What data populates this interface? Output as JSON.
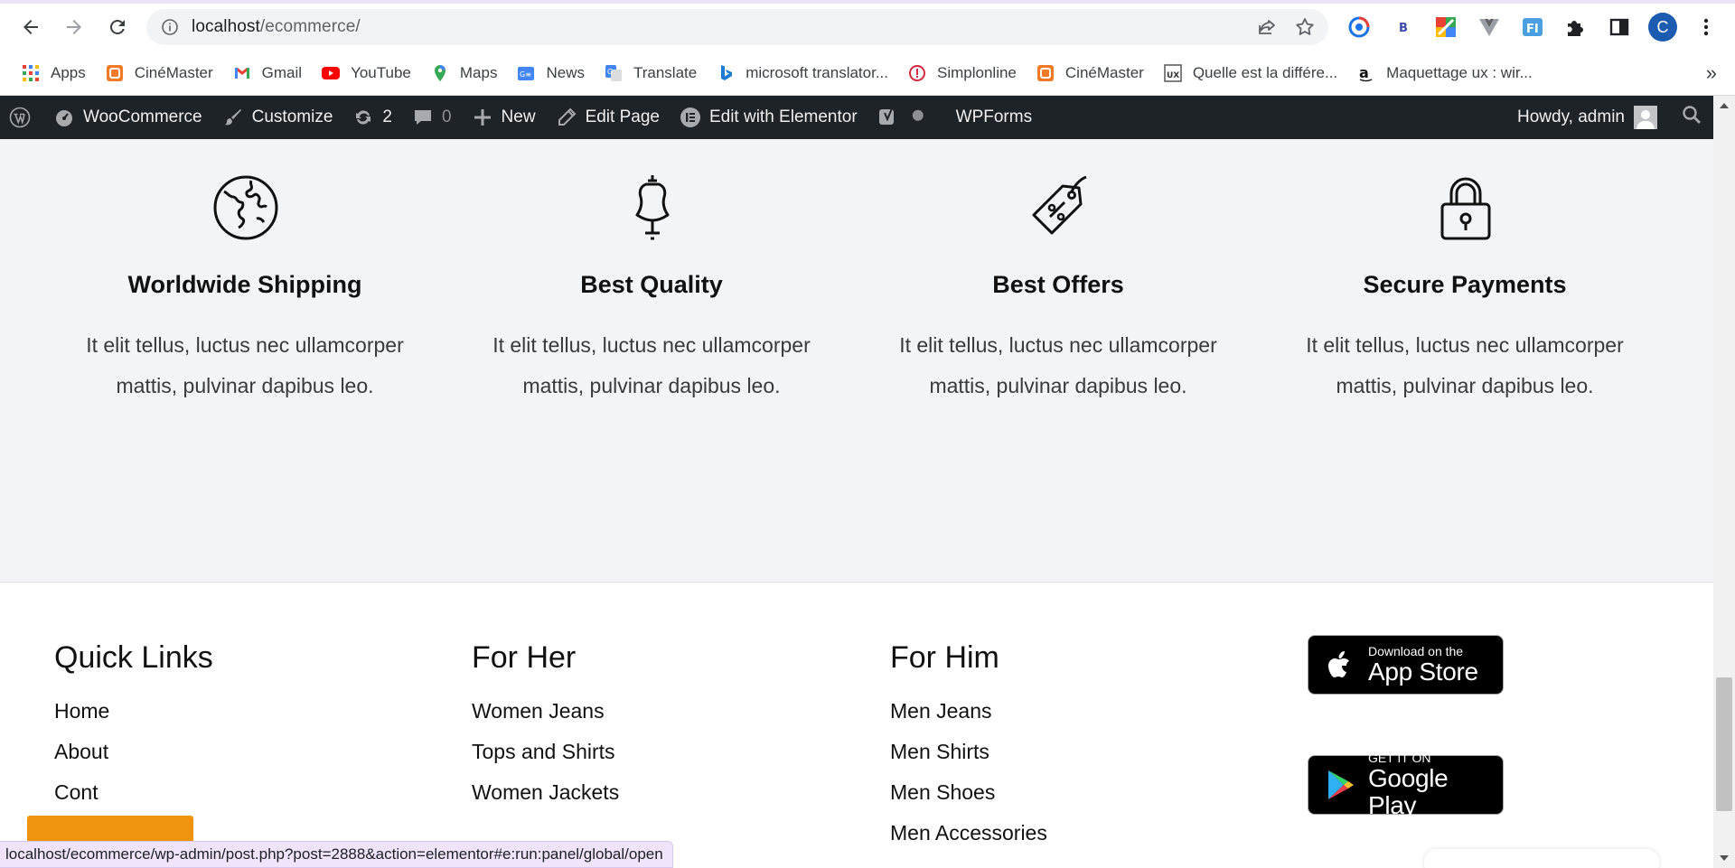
{
  "browser": {
    "url_host": "localhost",
    "url_path": "/ecommerce/",
    "profile_initial": "C",
    "extensions": [
      "sync-ext-icon",
      "b-ext-icon",
      "colorful-ext-icon",
      "vue-devtools-icon",
      "fi-ext-icon",
      "puzzle-icon",
      "sidebar-icon"
    ],
    "bookmarks": [
      {
        "label": "Apps",
        "icon": "apps-grid-icon"
      },
      {
        "label": "CinéMaster",
        "icon": "cinemaster-icon"
      },
      {
        "label": "Gmail",
        "icon": "gmail-icon"
      },
      {
        "label": "YouTube",
        "icon": "youtube-icon"
      },
      {
        "label": "Maps",
        "icon": "maps-icon"
      },
      {
        "label": "News",
        "icon": "news-icon"
      },
      {
        "label": "Translate",
        "icon": "translate-icon"
      },
      {
        "label": "microsoft translator...",
        "icon": "bing-icon"
      },
      {
        "label": "Simplonline",
        "icon": "simplonline-icon"
      },
      {
        "label": "CinéMaster",
        "icon": "cinemaster-icon"
      },
      {
        "label": "Quelle est la différe...",
        "icon": "ux-icon"
      },
      {
        "label": "Maquettage ux : wir...",
        "icon": "amazon-icon"
      }
    ],
    "bookmarks_overflow": "»"
  },
  "adminbar": {
    "woocommerce": "WooCommerce",
    "customize": "Customize",
    "updates_count": "2",
    "comments_count": "0",
    "new": "New",
    "edit_page": "Edit Page",
    "edit_elementor": "Edit with Elementor",
    "wpforms": "WPForms",
    "howdy": "Howdy, admin"
  },
  "features": [
    {
      "title": "Worldwide Shipping",
      "text": "It elit tellus, luctus nec ullamcorper mattis, pulvinar dapibus leo.",
      "icon": "globe-icon"
    },
    {
      "title": "Best Quality",
      "text": "It elit tellus, luctus nec ullamcorper mattis, pulvinar dapibus leo.",
      "icon": "mannequin-icon"
    },
    {
      "title": "Best Offers",
      "text": "It elit tellus, luctus nec ullamcorper mattis, pulvinar dapibus leo.",
      "icon": "price-tag-icon"
    },
    {
      "title": "Secure Payments",
      "text": "It elit tellus, luctus nec ullamcorper mattis, pulvinar dapibus leo.",
      "icon": "padlock-icon"
    }
  ],
  "footer": {
    "quick_links": {
      "title": "Quick Links",
      "items": [
        "Home",
        "About",
        "Cont"
      ]
    },
    "for_her": {
      "title": "For Her",
      "items": [
        "Women Jeans",
        "Tops and Shirts",
        "Women Jackets"
      ]
    },
    "for_him": {
      "title": "For Him",
      "items": [
        "Men Jeans",
        "Men Shirts",
        "Men Shoes",
        "Men Accessories"
      ]
    },
    "app_store": {
      "small": "Download on the",
      "big": "App Store"
    },
    "google_play": {
      "small": "GET IT ON",
      "big": "Google Play"
    }
  },
  "status_url": "localhost/ecommerce/wp-admin/post.php?post=2888&action=elementor#e:run:panel/global/open",
  "colors": {
    "adminbar": "#1d2327",
    "features_bg": "#f3f4f5",
    "translate_btn": "#f0940e"
  }
}
